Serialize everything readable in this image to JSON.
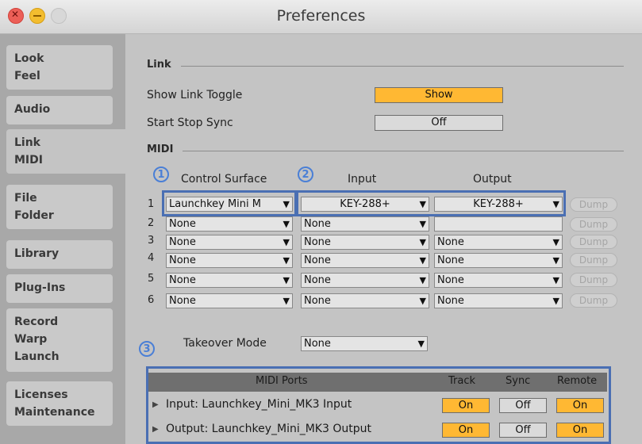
{
  "window": {
    "title": "Preferences"
  },
  "sidebar": {
    "tabs": [
      {
        "lines": [
          "Look",
          "Feel"
        ]
      },
      {
        "lines": [
          "Audio"
        ]
      },
      {
        "lines": [
          "Link",
          "MIDI"
        ]
      },
      {
        "lines": [
          "File",
          "Folder"
        ]
      },
      {
        "lines": [
          "Library"
        ]
      },
      {
        "lines": [
          "Plug-Ins"
        ]
      },
      {
        "lines": [
          "Record",
          "Warp",
          "Launch"
        ]
      },
      {
        "lines": [
          "Licenses",
          "Maintenance"
        ]
      }
    ]
  },
  "link": {
    "section_label": "Link",
    "show_toggle_label": "Show Link Toggle",
    "show_toggle_value": "Show",
    "start_stop_label": "Start Stop Sync",
    "start_stop_value": "Off"
  },
  "midi": {
    "section_label": "MIDI",
    "headers": {
      "control_surface": "Control Surface",
      "input": "Input",
      "output": "Output"
    },
    "dump_label": "Dump",
    "rows": [
      {
        "num": "1",
        "surface": "Launchkey Mini M",
        "input": "KEY-288+",
        "output": "KEY-288+"
      },
      {
        "num": "2",
        "surface": "None",
        "input": "None",
        "output": ""
      },
      {
        "num": "3",
        "surface": "None",
        "input": "None",
        "output": "None"
      },
      {
        "num": "4",
        "surface": "None",
        "input": "None",
        "output": "None"
      },
      {
        "num": "5",
        "surface": "None",
        "input": "None",
        "output": "None"
      },
      {
        "num": "6",
        "surface": "None",
        "input": "None",
        "output": "None"
      }
    ],
    "takeover_label": "Takeover Mode",
    "takeover_value": "None"
  },
  "annotations": {
    "badge1": "1",
    "badge2": "2",
    "badge3": "3"
  },
  "ports": {
    "headers": {
      "name": "MIDI Ports",
      "track": "Track",
      "sync": "Sync",
      "remote": "Remote"
    },
    "rows": [
      {
        "label": "Input:   Launchkey_Mini_MK3 Input",
        "track": "On",
        "sync": "Off",
        "remote": "On"
      },
      {
        "label": "Output: Launchkey_Mini_MK3 Output",
        "track": "On",
        "sync": "Off",
        "remote": "On"
      }
    ]
  },
  "colors": {
    "accent": "#ffb833",
    "highlight": "#4a6fb3",
    "badge": "#4a7fd6"
  }
}
